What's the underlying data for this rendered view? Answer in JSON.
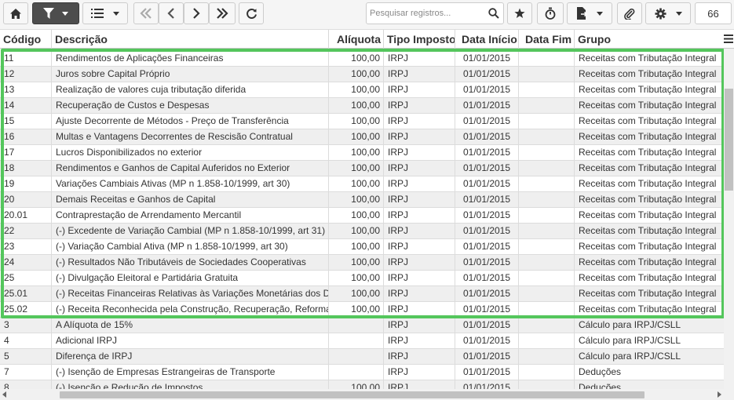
{
  "toolbar": {
    "search_placeholder": "Pesquisar registros...",
    "page_size": "66"
  },
  "columns": [
    "Código",
    "Descrição",
    "Alíquota",
    "Tipo Imposto",
    "Data Início",
    "Data Fim",
    "Grupo"
  ],
  "rows": [
    {
      "codigo": "11",
      "descricao": "Rendimentos de Aplicações Financeiras",
      "aliquota": "100,00",
      "tipo": "IRPJ",
      "inicio": "01/01/2015",
      "fim": "",
      "grupo": "Receitas com Tributação Integral"
    },
    {
      "codigo": "12",
      "descricao": "Juros sobre Capital Próprio",
      "aliquota": "100,00",
      "tipo": "IRPJ",
      "inicio": "01/01/2015",
      "fim": "",
      "grupo": "Receitas com Tributação Integral"
    },
    {
      "codigo": "13",
      "descricao": "Realização de valores cuja tributação diferida",
      "aliquota": "100,00",
      "tipo": "IRPJ",
      "inicio": "01/01/2015",
      "fim": "",
      "grupo": "Receitas com Tributação Integral"
    },
    {
      "codigo": "14",
      "descricao": "Recuperação de Custos e Despesas",
      "aliquota": "100,00",
      "tipo": "IRPJ",
      "inicio": "01/01/2015",
      "fim": "",
      "grupo": "Receitas com Tributação Integral"
    },
    {
      "codigo": "15",
      "descricao": "Ajuste Decorrente de Métodos - Preço de Transferência",
      "aliquota": "100,00",
      "tipo": "IRPJ",
      "inicio": "01/01/2015",
      "fim": "",
      "grupo": "Receitas com Tributação Integral"
    },
    {
      "codigo": "16",
      "descricao": "Multas e Vantagens Decorrentes de Rescisão Contratual",
      "aliquota": "100,00",
      "tipo": "IRPJ",
      "inicio": "01/01/2015",
      "fim": "",
      "grupo": "Receitas com Tributação Integral"
    },
    {
      "codigo": "17",
      "descricao": "Lucros Disponibilizados no exterior",
      "aliquota": "100,00",
      "tipo": "IRPJ",
      "inicio": "01/01/2015",
      "fim": "",
      "grupo": "Receitas com Tributação Integral"
    },
    {
      "codigo": "18",
      "descricao": "Rendimentos e Ganhos de Capital Auferidos no Exterior",
      "aliquota": "100,00",
      "tipo": "IRPJ",
      "inicio": "01/01/2015",
      "fim": "",
      "grupo": "Receitas com Tributação Integral"
    },
    {
      "codigo": "19",
      "descricao": "Variações Cambiais Ativas (MP n 1.858-10/1999, art 30)",
      "aliquota": "100,00",
      "tipo": "IRPJ",
      "inicio": "01/01/2015",
      "fim": "",
      "grupo": "Receitas com Tributação Integral"
    },
    {
      "codigo": "20",
      "descricao": "Demais Receitas e Ganhos de Capital",
      "aliquota": "100,00",
      "tipo": "IRPJ",
      "inicio": "01/01/2015",
      "fim": "",
      "grupo": "Receitas com Tributação Integral"
    },
    {
      "codigo": "20.01",
      "descricao": "Contraprestação de Arrendamento Mercantil",
      "aliquota": "100,00",
      "tipo": "IRPJ",
      "inicio": "01/01/2015",
      "fim": "",
      "grupo": "Receitas com Tributação Integral"
    },
    {
      "codigo": "22",
      "descricao": "(-) Excedente de Variação Cambial (MP n 1.858-10/1999, art 31)",
      "aliquota": "100,00",
      "tipo": "IRPJ",
      "inicio": "01/01/2015",
      "fim": "",
      "grupo": "Receitas com Tributação Integral"
    },
    {
      "codigo": "23",
      "descricao": "(-) Variação Cambial Ativa (MP n 1.858-10/1999, art 30)",
      "aliquota": "100,00",
      "tipo": "IRPJ",
      "inicio": "01/01/2015",
      "fim": "",
      "grupo": "Receitas com Tributação Integral"
    },
    {
      "codigo": "24",
      "descricao": "(-) Resultados Não Tributáveis de Sociedades Cooperativas",
      "aliquota": "100,00",
      "tipo": "IRPJ",
      "inicio": "01/01/2015",
      "fim": "",
      "grupo": "Receitas com Tributação Integral"
    },
    {
      "codigo": "25",
      "descricao": "(-) Divulgação Eleitoral e Partidária Gratuita",
      "aliquota": "100,00",
      "tipo": "IRPJ",
      "inicio": "01/01/2015",
      "fim": "",
      "grupo": "Receitas com Tributação Integral"
    },
    {
      "codigo": "25.01",
      "descricao": "(-) Receitas Financeiras Relativas às Variações Monetárias dos D",
      "aliquota": "100,00",
      "tipo": "IRPJ",
      "inicio": "01/01/2015",
      "fim": "",
      "grupo": "Receitas com Tributação Integral"
    },
    {
      "codigo": "25.02",
      "descricao": "(-) Receita Reconhecida pela Construção, Recuperação, Reforma",
      "aliquota": "100,00",
      "tipo": "IRPJ",
      "inicio": "01/01/2015",
      "fim": "",
      "grupo": "Receitas com Tributação Integral"
    },
    {
      "codigo": "3",
      "descricao": "A Alíquota de 15%",
      "aliquota": "",
      "tipo": "IRPJ",
      "inicio": "01/01/2015",
      "fim": "",
      "grupo": "Cálculo para IRPJ/CSLL"
    },
    {
      "codigo": "4",
      "descricao": "Adicional IRPJ",
      "aliquota": "",
      "tipo": "IRPJ",
      "inicio": "01/01/2015",
      "fim": "",
      "grupo": "Cálculo para IRPJ/CSLL"
    },
    {
      "codigo": "5",
      "descricao": "Diferença de IRPJ",
      "aliquota": "",
      "tipo": "IRPJ",
      "inicio": "01/01/2015",
      "fim": "",
      "grupo": "Cálculo para IRPJ/CSLL"
    },
    {
      "codigo": "7",
      "descricao": "(-) Isenção de Empresas Estrangeiras de Transporte",
      "aliquota": "",
      "tipo": "IRPJ",
      "inicio": "01/01/2015",
      "fim": "",
      "grupo": "Deduções"
    },
    {
      "codigo": "8",
      "descricao": "(-) Isenção e Redução de Impostos",
      "aliquota": "100,00",
      "tipo": "IRPJ",
      "inicio": "01/01/2015",
      "fim": "",
      "grupo": "Deduções"
    }
  ],
  "colors": {
    "highlight": "#54c65c",
    "active_button": "#4d4d4d",
    "row_alt": "#efefef"
  }
}
